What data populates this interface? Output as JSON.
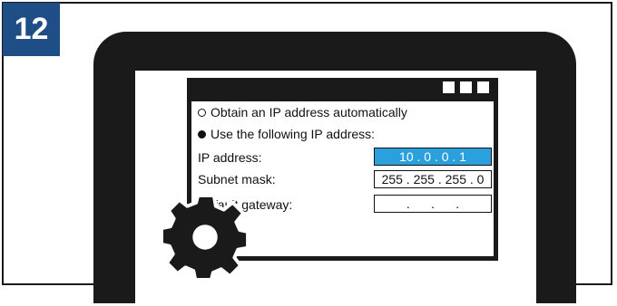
{
  "step": {
    "number": "12"
  },
  "dialog": {
    "option_auto": "Obtain an IP address automatically",
    "option_manual": "Use the following IP address:",
    "selected_option": "manual",
    "fields": {
      "ip_label": "IP address:",
      "ip_value": "10 . 0 . 0 . 1",
      "subnet_label": "Subnet mask:",
      "subnet_value": "255 . 255 . 255 . 0",
      "gateway_label": "Default gateway:",
      "gateway_value": ".      .      ."
    }
  },
  "colors": {
    "badge": "#1f4e87",
    "highlight": "#2aa0dc",
    "ink": "#1a1a1a"
  },
  "icons": [
    "gear-icon",
    "window-controls"
  ]
}
